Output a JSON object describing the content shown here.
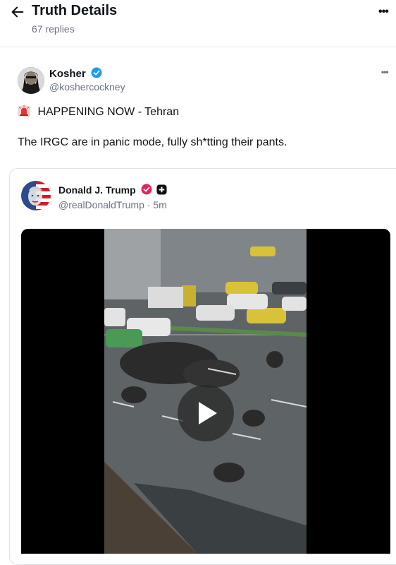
{
  "header": {
    "title": "Truth Details",
    "reply_count": "67 replies",
    "back_icon": "arrow-left-icon",
    "more_icon": "more-horizontal-icon"
  },
  "post": {
    "author_name": "Kosher",
    "author_handle": "@koshercockney",
    "verified_icon": "verified-badge-icon",
    "siren_icon": "siren-emoji-icon",
    "line1": "HAPPENING NOW - Tehran",
    "line2": "The IRGC are in panic mode, fully sh*tting their pants."
  },
  "quoted": {
    "author_name": "Donald J. Trump",
    "author_handle": "@realDonaldTrump",
    "separator": "·",
    "time": "5m",
    "badge_icons": [
      "verified-badge-icon",
      "plus-badge-icon"
    ]
  },
  "video": {
    "play_icon": "play-icon"
  },
  "colors": {
    "verified_blue": "#1d9bf0",
    "verified_red": "#e0245e",
    "text": "#0f1419",
    "muted": "#6b7280",
    "border": "#e6e9ec"
  }
}
